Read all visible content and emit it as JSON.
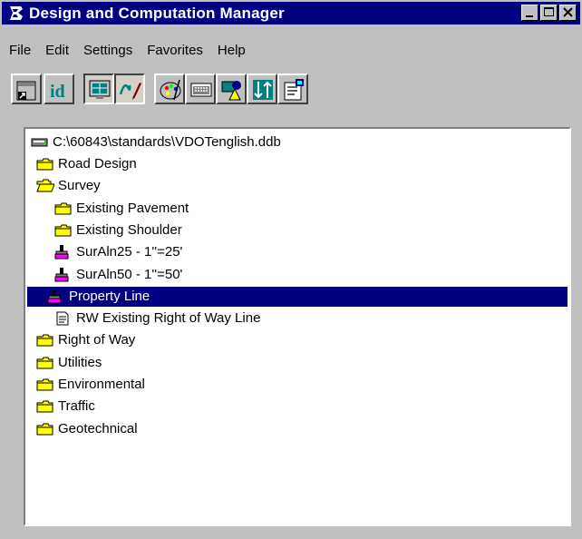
{
  "window": {
    "title": "Design and Computation Manager"
  },
  "menu": [
    "File",
    "Edit",
    "Settings",
    "Favorites",
    "Help"
  ],
  "toolbar": {
    "tools": [
      "place-cell-icon",
      "id-icon",
      "monitor-icon",
      "draw-pen-icon",
      "palette-icon",
      "keyboard-icon",
      "shapes-icon",
      "sort-icon",
      "properties-icon"
    ]
  },
  "tree": {
    "root": "C:\\60843\\standards\\VDOTenglish.ddb",
    "items": [
      {
        "label": "Road Design",
        "icon": "folder-icon"
      },
      {
        "label": "Survey",
        "icon": "open-folder-icon"
      },
      {
        "label": "Existing Pavement",
        "icon": "folder-icon"
      },
      {
        "label": "Existing Shoulder",
        "icon": "folder-icon"
      },
      {
        "label": "SurAln25 - 1''=25'",
        "icon": "brush-icon"
      },
      {
        "label": "SurAln50 - 1''=50'",
        "icon": "brush-icon"
      },
      {
        "label": "Property Line",
        "icon": "brush-icon"
      },
      {
        "label": "RW Existing Right of Way Line",
        "icon": "document-icon"
      },
      {
        "label": "Right of Way",
        "icon": "folder-icon"
      },
      {
        "label": "Utilities",
        "icon": "folder-icon"
      },
      {
        "label": "Environmental",
        "icon": "folder-icon"
      },
      {
        "label": "Traffic",
        "icon": "folder-icon"
      },
      {
        "label": "Geotechnical",
        "icon": "folder-icon"
      }
    ],
    "selected": "Property Line"
  },
  "colors": {
    "titlebar": "#000080",
    "selection": "#000080",
    "folder": "#ffff00"
  }
}
